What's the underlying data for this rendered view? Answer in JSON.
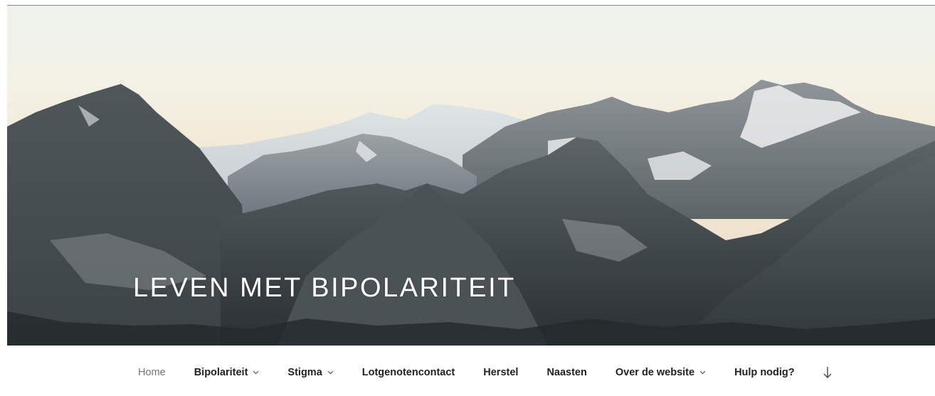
{
  "site": {
    "title": "LEVEN MET BIPOLARITEIT"
  },
  "hero": {
    "image_description_icon": "mountain-landscape-image"
  },
  "nav": {
    "items": [
      {
        "label": "Home",
        "current": true,
        "has_submenu": false
      },
      {
        "label": "Bipolariteit",
        "current": false,
        "has_submenu": true
      },
      {
        "label": "Stigma",
        "current": false,
        "has_submenu": true
      },
      {
        "label": "Lotgenotencontact",
        "current": false,
        "has_submenu": false
      },
      {
        "label": "Herstel",
        "current": false,
        "has_submenu": false
      },
      {
        "label": "Naasten",
        "current": false,
        "has_submenu": false
      },
      {
        "label": "Over de website",
        "current": false,
        "has_submenu": true
      },
      {
        "label": "Hulp nodig?",
        "current": false,
        "has_submenu": false
      }
    ],
    "scroll_icon": "arrow-down-icon"
  },
  "colors": {
    "nav_text": "#222222",
    "nav_current": "#767676",
    "title_text": "#ffffff"
  }
}
